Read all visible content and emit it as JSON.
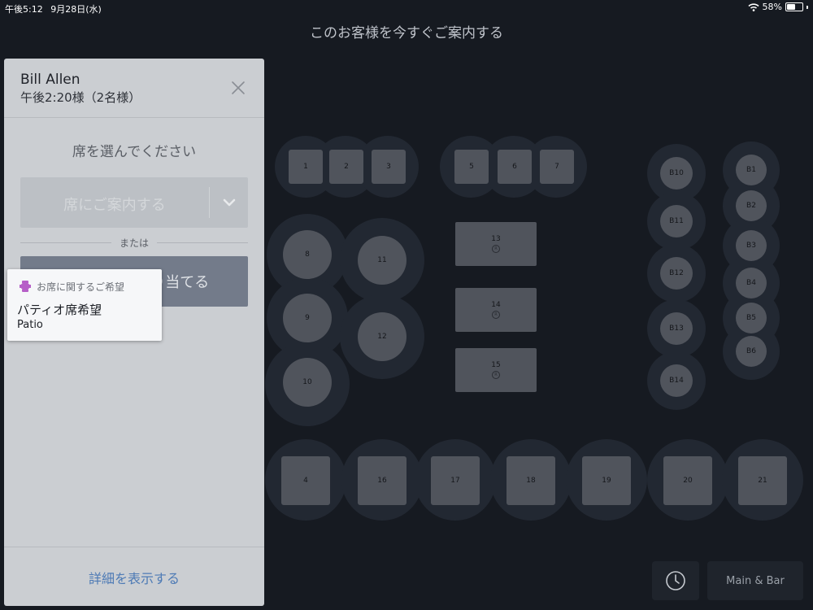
{
  "status_bar": {
    "time": "午後5:12",
    "date": "9月28日(水)",
    "battery_level": "58%",
    "wifi_icon": "wifi-icon",
    "battery_icon": "battery-icon"
  },
  "header": {
    "title": "このお客様を今すぐご案内する"
  },
  "panel": {
    "guest_name": "Bill Allen",
    "reservation": "午後2:20様（2名様）",
    "close_icon": "close-icon",
    "choose_seat_label": "席を選んでください",
    "seat_button_label": "席にご案内する",
    "dropdown_icon": "chevron-down-icon",
    "or_label": "または",
    "assign_button_label": "午後2:20に割り当てる",
    "preference": {
      "icon": "seat-preference-icon",
      "heading": "お席に関するご希望",
      "title": "パティオ席希望",
      "note": "Patio"
    },
    "details_link": "詳細を表示する"
  },
  "floor": {
    "tables": {
      "t1": "1",
      "t2": "2",
      "t3": "3",
      "t5": "5",
      "t6": "6",
      "t7": "7",
      "t8": "8",
      "t9": "9",
      "t10": "10",
      "t11": "11",
      "t12": "12",
      "t13": "13",
      "t14": "14",
      "t15": "15",
      "t4": "4",
      "t16": "16",
      "t17": "17",
      "t18": "18",
      "t19": "19",
      "t20": "20",
      "t21": "21",
      "b10": "B10",
      "b11": "B11",
      "b12": "B12",
      "b13": "B13",
      "b14": "B14",
      "b1": "B1",
      "b2": "B2",
      "b3": "B3",
      "b4": "B4",
      "b5": "B5",
      "b6": "B6"
    }
  },
  "bottom_bar": {
    "clock_icon": "clock-icon",
    "area_button_label": "Main & Bar"
  },
  "colors": {
    "background": "#161a21",
    "panel": "#cbced2",
    "assign_button": "#737b8a",
    "link": "#4d7ab5",
    "preference_icon": "#b65fc7"
  }
}
